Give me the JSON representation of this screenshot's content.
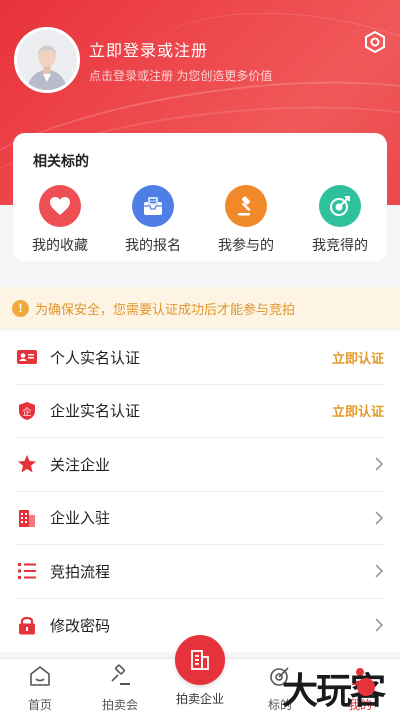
{
  "header": {
    "login_title": "立即登录或注册",
    "login_subtitle": "点击登录或注册 为您创造更多价值",
    "settings_icon": "settings-hexagon-icon",
    "accent": "#e8323a"
  },
  "card": {
    "title": "相关标的",
    "tiles": [
      {
        "label": "我的收藏",
        "icon": "heart-icon",
        "color": "#ee4f55"
      },
      {
        "label": "我的报名",
        "icon": "inbox-icon",
        "color": "#4f7fe6"
      },
      {
        "label": "我参与的",
        "icon": "gavel-icon",
        "color": "#f0892a"
      },
      {
        "label": "我竞得的",
        "icon": "target-icon",
        "color": "#2fc19c"
      }
    ]
  },
  "notice": {
    "icon": "info-icon",
    "text": "为确保安全，您需要认证成功后才能参与竞拍"
  },
  "list": [
    {
      "label": "个人实名认证",
      "icon": "id-card-icon",
      "action": "立即认证"
    },
    {
      "label": "企业实名认证",
      "icon": "enterprise-shield-icon",
      "action": "立即认证"
    },
    {
      "label": "关注企业",
      "icon": "star-icon",
      "action": ""
    },
    {
      "label": "企业入驻",
      "icon": "building-icon",
      "action": ""
    },
    {
      "label": "竞拍流程",
      "icon": "list-steps-icon",
      "action": ""
    },
    {
      "label": "修改密码",
      "icon": "lock-icon",
      "action": ""
    }
  ],
  "tabbar": {
    "tabs": [
      {
        "label": "首页",
        "icon": "home-icon"
      },
      {
        "label": "拍卖会",
        "icon": "gavel-icon"
      },
      {
        "label": "拍卖企业",
        "icon": "building-icon"
      },
      {
        "label": "标的",
        "icon": "target-icon"
      },
      {
        "label": "我的",
        "icon": "user-icon"
      }
    ]
  },
  "watermark": "大玩客"
}
